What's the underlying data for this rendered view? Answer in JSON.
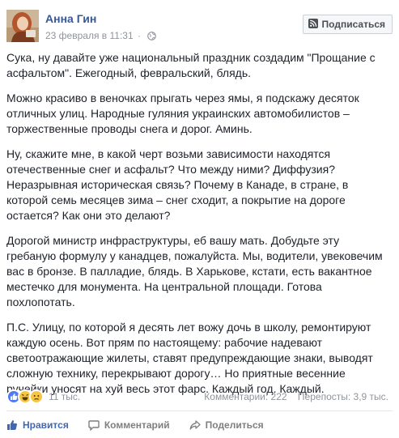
{
  "post": {
    "author": "Анна Гин",
    "date": "23 февраля в 11:31",
    "separator": "·",
    "subscribe_label": "Подписаться",
    "paragraphs": [
      "Сука, ну давайте уже национальный праздник создадим \"Прощание с асфальтом\". Ежегодный, февральский, блядь.",
      "Можно красиво в веночках прыгать через ямы, я подскажу десяток отличных улиц. Народные гуляния украинских автомобилистов – торжественные проводы снега и дорог. Аминь.",
      "Ну, скажите мне, в какой черт возьми зависимости находятся отечественные снег и асфальт? Что между ними? Диффузия? Неразрывная историческая связь? Почему в Канаде, в стране, в которой семь месяцев зима – снег сходит, а покрытие на дороге остается? Как они это делают?",
      "Дорогой министр инфраструктуры, еб вашу мать. Добудьте эту гребаную формулу у канадцев, пожалуйста. Мы, водители, увековечим вас в бронзе. В палладие, блядь. В Харькове, кстати, есть вакантное местечко для монумента. На центральной площади. Готова похлопотать.",
      "П.С. Улицу, по которой я десять лет вожу дочь в школу, ремонтируют каждую осень. Вот прям по настоящему: рабочие надевают светоотражающие жилеты, ставят предупреждающие знаки, выводят сложную технику, перекрывают дорогу… Но приятные весенние ручейки уносят на хуй весь этот фарс. Каждый год. Каждый."
    ]
  },
  "reactions": {
    "icons": [
      "like-icon",
      "haha-icon",
      "sad-icon"
    ],
    "count": "11 тыс.",
    "comments": "Комментарии: 222",
    "shares": "Перепосты: 3,9 тыс."
  },
  "actions": {
    "like": "Нравится",
    "comment": "Комментарий",
    "share": "Поделиться"
  },
  "colors": {
    "link": "#365899",
    "meta": "#90949c",
    "like_active": "#4267b2"
  }
}
